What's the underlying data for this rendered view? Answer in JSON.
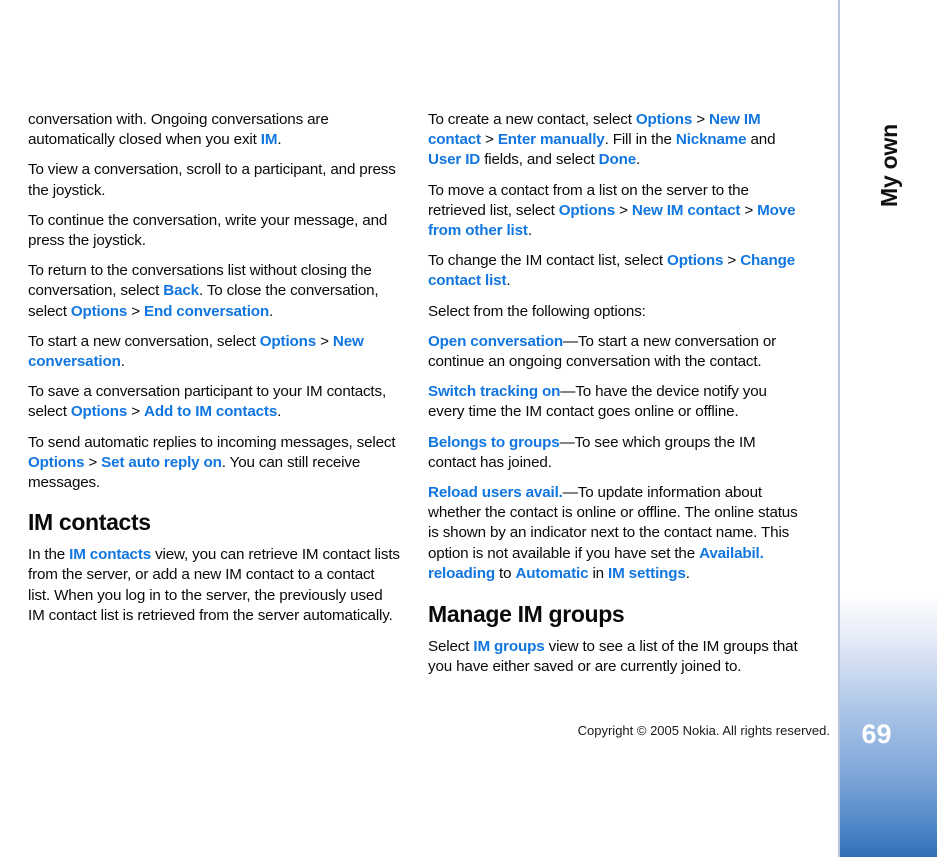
{
  "document": {
    "sidebar_label": "My own",
    "page_number": "69",
    "copyright": "Copyright © 2005 Nokia. All rights reserved.",
    "accent_color": "#1176e0",
    "sidebar_border_color": "#b9c6e3",
    "sidebar_gradient_end": "#2f6fb5"
  },
  "left_column": {
    "p1": {
      "t1": "conversation with. Ongoing conversations are automatically closed when you exit ",
      "k1": "IM",
      "t2": "."
    },
    "p2": {
      "t1": "To view a conversation, scroll to a participant, and press the joystick."
    },
    "p3": {
      "t1": "To continue the conversation, write your message, and press the joystick."
    },
    "p4": {
      "t1": "To return to the conversations list without closing the conversation, select ",
      "k1": "Back",
      "t2": ". To close the conversation, select ",
      "k2": "Options",
      "s1": " > ",
      "k3": "End conversation",
      "t3": "."
    },
    "p5": {
      "t1": "To start a new conversation, select ",
      "k1": "Options",
      "s1": " > ",
      "k2": "New conversation",
      "t2": "."
    },
    "p6": {
      "t1": "To save a conversation participant to your IM contacts, select ",
      "k1": "Options",
      "s1": " > ",
      "k2": "Add to IM contacts",
      "t2": "."
    },
    "p7": {
      "t1": "To send automatic replies to incoming messages, select ",
      "k1": "Options",
      "s1": " > ",
      "k2": "Set auto reply on",
      "t2": ". You can still receive messages."
    },
    "heading": "IM contacts",
    "p8": {
      "t1": "In the ",
      "k1": "IM contacts",
      "t2": " view, you can retrieve IM contact lists from the server, or add a new IM contact to a contact list. When you log in to the server, the previously used IM contact list is retrieved from the server automatically."
    }
  },
  "right_column": {
    "p1": {
      "t1": "To create a new contact, select ",
      "k1": "Options",
      "s1": " > ",
      "k2": "New IM contact",
      "s2": " > ",
      "k3": "Enter manually",
      "t2": ". Fill in the ",
      "k4": "Nickname",
      "t3": " and ",
      "k5": "User ID",
      "t4": " fields, and select ",
      "k6": "Done",
      "t5": "."
    },
    "p2": {
      "t1": "To move a contact from a list on the server to the retrieved list, select ",
      "k1": "Options",
      "s1": " > ",
      "k2": "New IM contact",
      "s2": " > ",
      "k3": "Move from other list",
      "t2": "."
    },
    "p3": {
      "t1": "To change the IM contact list, select ",
      "k1": "Options",
      "s1": " > ",
      "k2": "Change contact list",
      "t2": "."
    },
    "p4": {
      "t1": "Select from the following options:"
    },
    "option1": {
      "k1": "Open conversation",
      "t1": "—To start a new conversation or continue an ongoing conversation with the contact."
    },
    "option2": {
      "k1": "Switch tracking on",
      "t1": "—To have the device notify you every time the IM contact goes online or offline."
    },
    "option3": {
      "k1": "Belongs to groups",
      "t1": "—To see which groups the IM contact has joined."
    },
    "option4": {
      "k1": "Reload users avail.",
      "t1": "—To update information about whether the contact is online or offline. The online status is shown by an indicator next to the contact name. This option is not available if you have set the ",
      "k2": "Availabil. reloading",
      "t2": " to ",
      "k3": "Automatic",
      "t3": " in ",
      "k4": "IM settings",
      "t4": "."
    },
    "heading": "Manage IM groups",
    "p5": {
      "t1": "Select ",
      "k1": "IM groups",
      "t2": " view to see a list of the IM groups that you have either saved or are currently joined to."
    }
  }
}
